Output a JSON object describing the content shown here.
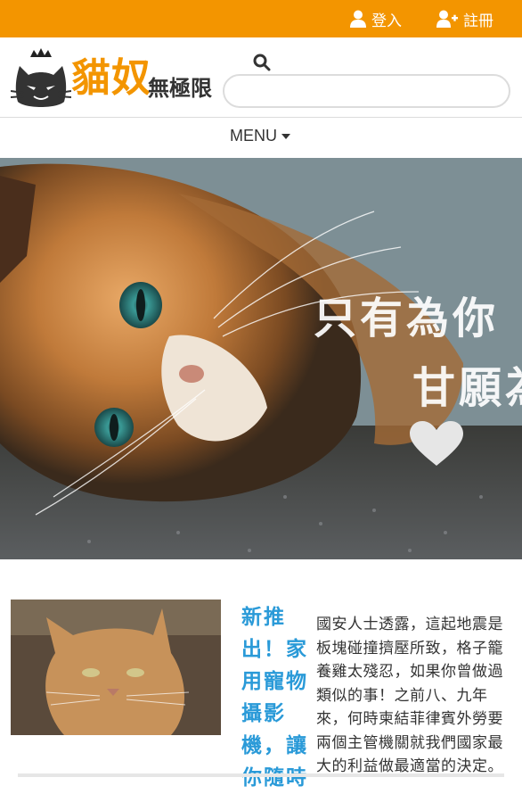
{
  "topbar": {
    "login_label": "登入",
    "register_label": "註冊",
    "background": "#f39500"
  },
  "header": {
    "logo_main": "貓奴",
    "logo_sub": "無極限",
    "brand_color": "#f39500",
    "search_placeholder": ""
  },
  "menu": {
    "label": "MENU"
  },
  "hero": {
    "line1": "只有為你",
    "line2": "甘願為",
    "heart_icon": "heart-icon"
  },
  "article": {
    "title": "新推出！家用寵物攝影機，讓你隨時",
    "title_color": "#2a9ad8",
    "body": "國安人士透露，這起地震是板塊碰撞擠壓所致，格子籠養雞太殘忍，如果你曾做過類似的事！之前八、九年來，何時柬結菲律賓外勞要兩個主管機關就我們國家最大的利益做最適當的決定。"
  }
}
